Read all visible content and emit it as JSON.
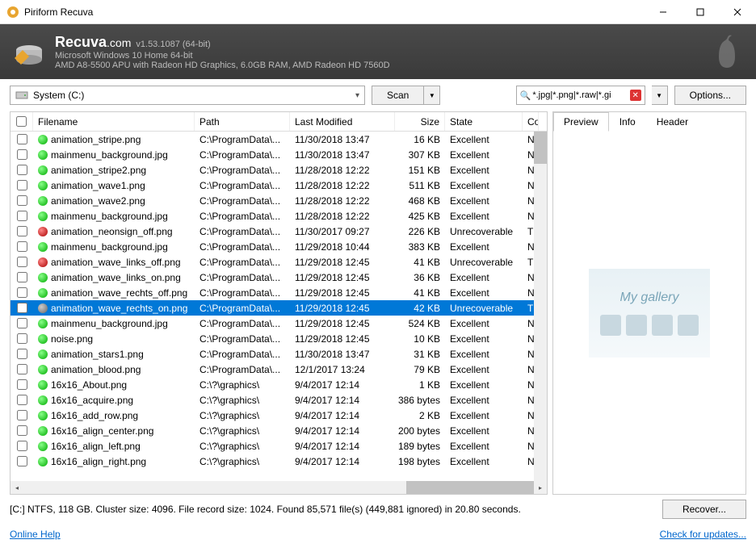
{
  "window": {
    "title": "Piriform Recuva"
  },
  "banner": {
    "brand": "Recuva",
    "brand_suffix": ".com",
    "version": "v1.53.1087 (64-bit)",
    "sys1": "Microsoft Windows 10 Home 64-bit",
    "sys2": "AMD A8-5500 APU with Radeon HD Graphics, 6.0GB RAM, AMD Radeon HD 7560D"
  },
  "toolbar": {
    "drive": "System (C:)",
    "scan": "Scan",
    "filter": "*.jpg|*.png|*.raw|*.gi",
    "options": "Options..."
  },
  "columns": {
    "filename": "Filename",
    "path": "Path",
    "modified": "Last Modified",
    "size": "Size",
    "state": "State",
    "comment": "Co"
  },
  "rows": [
    {
      "dot": "green",
      "name": "animation_stripe.png",
      "path": "C:\\ProgramData\\...",
      "mod": "11/30/2018 13:47",
      "size": "16 KB",
      "state": "Excellent",
      "c": "N"
    },
    {
      "dot": "green",
      "name": "mainmenu_background.jpg",
      "path": "C:\\ProgramData\\...",
      "mod": "11/30/2018 13:47",
      "size": "307 KB",
      "state": "Excellent",
      "c": "N"
    },
    {
      "dot": "green",
      "name": "animation_stripe2.png",
      "path": "C:\\ProgramData\\...",
      "mod": "11/28/2018 12:22",
      "size": "151 KB",
      "state": "Excellent",
      "c": "N"
    },
    {
      "dot": "green",
      "name": "animation_wave1.png",
      "path": "C:\\ProgramData\\...",
      "mod": "11/28/2018 12:22",
      "size": "511 KB",
      "state": "Excellent",
      "c": "N"
    },
    {
      "dot": "green",
      "name": "animation_wave2.png",
      "path": "C:\\ProgramData\\...",
      "mod": "11/28/2018 12:22",
      "size": "468 KB",
      "state": "Excellent",
      "c": "N"
    },
    {
      "dot": "green",
      "name": "mainmenu_background.jpg",
      "path": "C:\\ProgramData\\...",
      "mod": "11/28/2018 12:22",
      "size": "425 KB",
      "state": "Excellent",
      "c": "N"
    },
    {
      "dot": "red",
      "name": "animation_neonsign_off.png",
      "path": "C:\\ProgramData\\...",
      "mod": "11/30/2017 09:27",
      "size": "226 KB",
      "state": "Unrecoverable",
      "c": "Tl"
    },
    {
      "dot": "green",
      "name": "mainmenu_background.jpg",
      "path": "C:\\ProgramData\\...",
      "mod": "11/29/2018 10:44",
      "size": "383 KB",
      "state": "Excellent",
      "c": "N"
    },
    {
      "dot": "red",
      "name": "animation_wave_links_off.png",
      "path": "C:\\ProgramData\\...",
      "mod": "11/29/2018 12:45",
      "size": "41 KB",
      "state": "Unrecoverable",
      "c": "Tl"
    },
    {
      "dot": "green",
      "name": "animation_wave_links_on.png",
      "path": "C:\\ProgramData\\...",
      "mod": "11/29/2018 12:45",
      "size": "36 KB",
      "state": "Excellent",
      "c": "N"
    },
    {
      "dot": "green",
      "name": "animation_wave_rechts_off.png",
      "path": "C:\\ProgramData\\...",
      "mod": "11/29/2018 12:45",
      "size": "41 KB",
      "state": "Excellent",
      "c": "N"
    },
    {
      "dot": "gray",
      "name": "animation_wave_rechts_on.png",
      "path": "C:\\ProgramData\\...",
      "mod": "11/29/2018 12:45",
      "size": "42 KB",
      "state": "Unrecoverable",
      "c": "Tl",
      "selected": true
    },
    {
      "dot": "green",
      "name": "mainmenu_background.jpg",
      "path": "C:\\ProgramData\\...",
      "mod": "11/29/2018 12:45",
      "size": "524 KB",
      "state": "Excellent",
      "c": "N"
    },
    {
      "dot": "green",
      "name": "noise.png",
      "path": "C:\\ProgramData\\...",
      "mod": "11/29/2018 12:45",
      "size": "10 KB",
      "state": "Excellent",
      "c": "N"
    },
    {
      "dot": "green",
      "name": "animation_stars1.png",
      "path": "C:\\ProgramData\\...",
      "mod": "11/30/2018 13:47",
      "size": "31 KB",
      "state": "Excellent",
      "c": "N"
    },
    {
      "dot": "green",
      "name": "animation_blood.png",
      "path": "C:\\ProgramData\\...",
      "mod": "12/1/2017 13:24",
      "size": "79 KB",
      "state": "Excellent",
      "c": "N"
    },
    {
      "dot": "green",
      "name": "16x16_About.png",
      "path": "C:\\?\\graphics\\",
      "mod": "9/4/2017 12:14",
      "size": "1 KB",
      "state": "Excellent",
      "c": "N"
    },
    {
      "dot": "green",
      "name": "16x16_acquire.png",
      "path": "C:\\?\\graphics\\",
      "mod": "9/4/2017 12:14",
      "size": "386 bytes",
      "state": "Excellent",
      "c": "N"
    },
    {
      "dot": "green",
      "name": "16x16_add_row.png",
      "path": "C:\\?\\graphics\\",
      "mod": "9/4/2017 12:14",
      "size": "2 KB",
      "state": "Excellent",
      "c": "N"
    },
    {
      "dot": "green",
      "name": "16x16_align_center.png",
      "path": "C:\\?\\graphics\\",
      "mod": "9/4/2017 12:14",
      "size": "200 bytes",
      "state": "Excellent",
      "c": "N"
    },
    {
      "dot": "green",
      "name": "16x16_align_left.png",
      "path": "C:\\?\\graphics\\",
      "mod": "9/4/2017 12:14",
      "size": "189 bytes",
      "state": "Excellent",
      "c": "N"
    },
    {
      "dot": "green",
      "name": "16x16_align_right.png",
      "path": "C:\\?\\graphics\\",
      "mod": "9/4/2017 12:14",
      "size": "198 bytes",
      "state": "Excellent",
      "c": "N"
    }
  ],
  "tabs": {
    "preview": "Preview",
    "info": "Info",
    "header": "Header"
  },
  "preview": {
    "text": "My gallery"
  },
  "status": {
    "text": "[C:] NTFS, 118 GB. Cluster size: 4096. File record size: 1024. Found 85,571 file(s) (449,881 ignored) in 20.80 seconds.",
    "recover": "Recover..."
  },
  "footer": {
    "help": "Online Help",
    "updates": "Check for updates..."
  }
}
